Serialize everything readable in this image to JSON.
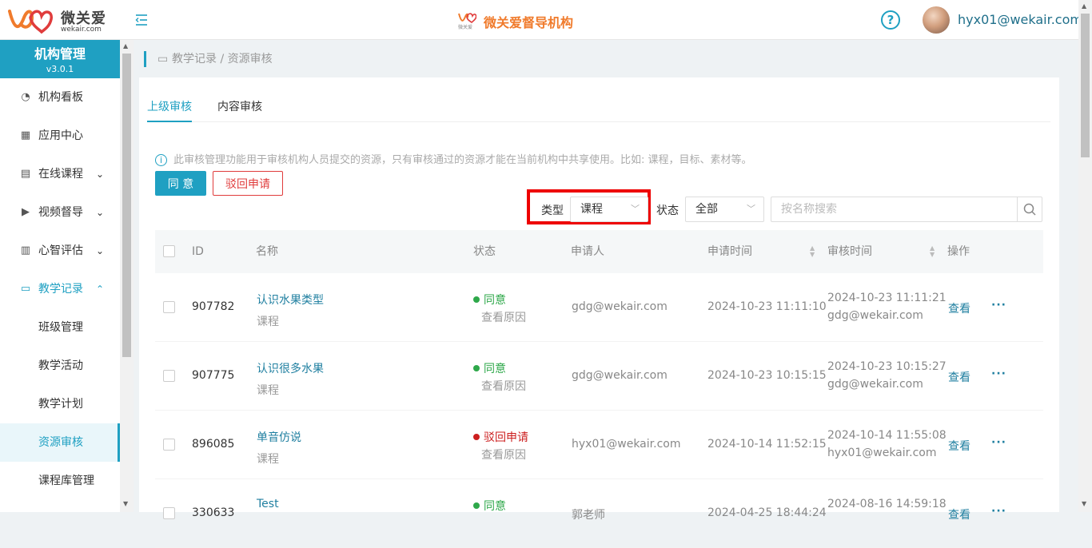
{
  "header": {
    "logo_text": "微关爱",
    "logo_sub": "wekair.com",
    "brand_small": "微关爱",
    "brand_title": "微关爱督导机构",
    "help_glyph": "?",
    "user_email": "hyx01@wekair.com"
  },
  "sidebar": {
    "title": "机构管理",
    "version": "v3.0.1",
    "items": [
      {
        "label": "机构看板",
        "icon": "pie-chart-icon",
        "glyph": "◔"
      },
      {
        "label": "应用中心",
        "icon": "grid-icon",
        "glyph": "▦"
      },
      {
        "label": "在线课程",
        "icon": "book-icon",
        "glyph": "▤",
        "arrow": "⌄"
      },
      {
        "label": "视频督导",
        "icon": "play-icon",
        "glyph": "▶",
        "arrow": "⌄"
      },
      {
        "label": "心智评估",
        "icon": "report-icon",
        "glyph": "▥",
        "arrow": "⌄"
      },
      {
        "label": "教学记录",
        "icon": "video-icon",
        "glyph": "▭",
        "arrow": "⌃"
      }
    ],
    "sub_items": [
      "班级管理",
      "教学活动",
      "教学计划",
      "资源审核",
      "课程库管理"
    ],
    "selected": "资源审核"
  },
  "breadcrumb": {
    "path": "教学记录 / 资源审核"
  },
  "tabs": [
    "上级审核",
    "内容审核"
  ],
  "notice": "此审核管理功能用于审核机构人员提交的资源，只有审核通过的资源才能在当前机构中共享使用。比如: 课程，目标、素材等。",
  "actions": {
    "agree": "同 意",
    "reject": "驳回申请"
  },
  "filters": {
    "type_label": "类型",
    "type_value": "课程",
    "status_label": "状态",
    "status_value": "全部",
    "search_placeholder": "按名称搜索"
  },
  "table": {
    "columns": [
      "ID",
      "名称",
      "状态",
      "申请人",
      "申请时间",
      "审核时间",
      "操作"
    ],
    "rows": [
      {
        "id": "907782",
        "name": "认识水果类型",
        "kind": "课程",
        "status": "同意",
        "status_type": "ok",
        "reason": "查看原因",
        "applicant": "gdg@wekair.com",
        "apply_time": "2024-10-23 11:11:10",
        "review_time": "2024-10-23 11:11:21",
        "reviewer": "gdg@wekair.com",
        "view": "查看",
        "more": "···"
      },
      {
        "id": "907775",
        "name": "认识很多水果",
        "kind": "课程",
        "status": "同意",
        "status_type": "ok",
        "reason": "查看原因",
        "applicant": "gdg@wekair.com",
        "apply_time": "2024-10-23 10:15:15",
        "review_time": "2024-10-23 10:15:27",
        "reviewer": "gdg@wekair.com",
        "view": "查看",
        "more": "···"
      },
      {
        "id": "896085",
        "name": "单音仿说",
        "kind": "课程",
        "status": "驳回申请",
        "status_type": "no",
        "reason": "查看原因",
        "applicant": "hyx01@wekair.com",
        "apply_time": "2024-10-14 11:52:15",
        "review_time": "2024-10-14 11:55:08",
        "reviewer": "hyx01@wekair.com",
        "view": "查看",
        "more": "···"
      },
      {
        "id": "330633",
        "name": "Test",
        "kind": "",
        "status": "同意",
        "status_type": "ok",
        "reason": "",
        "applicant": "郭老师",
        "apply_time": "2024-04-25 18:44:24",
        "review_time": "2024-08-16 14:59:18",
        "reviewer": "",
        "view": "查看",
        "more": "···"
      }
    ]
  },
  "colors": {
    "accent": "#1fa0c2",
    "danger": "#e03c3c",
    "success": "#2ea84a",
    "brand_orange": "#f07b2c",
    "highlight_box": "#ee0000"
  }
}
